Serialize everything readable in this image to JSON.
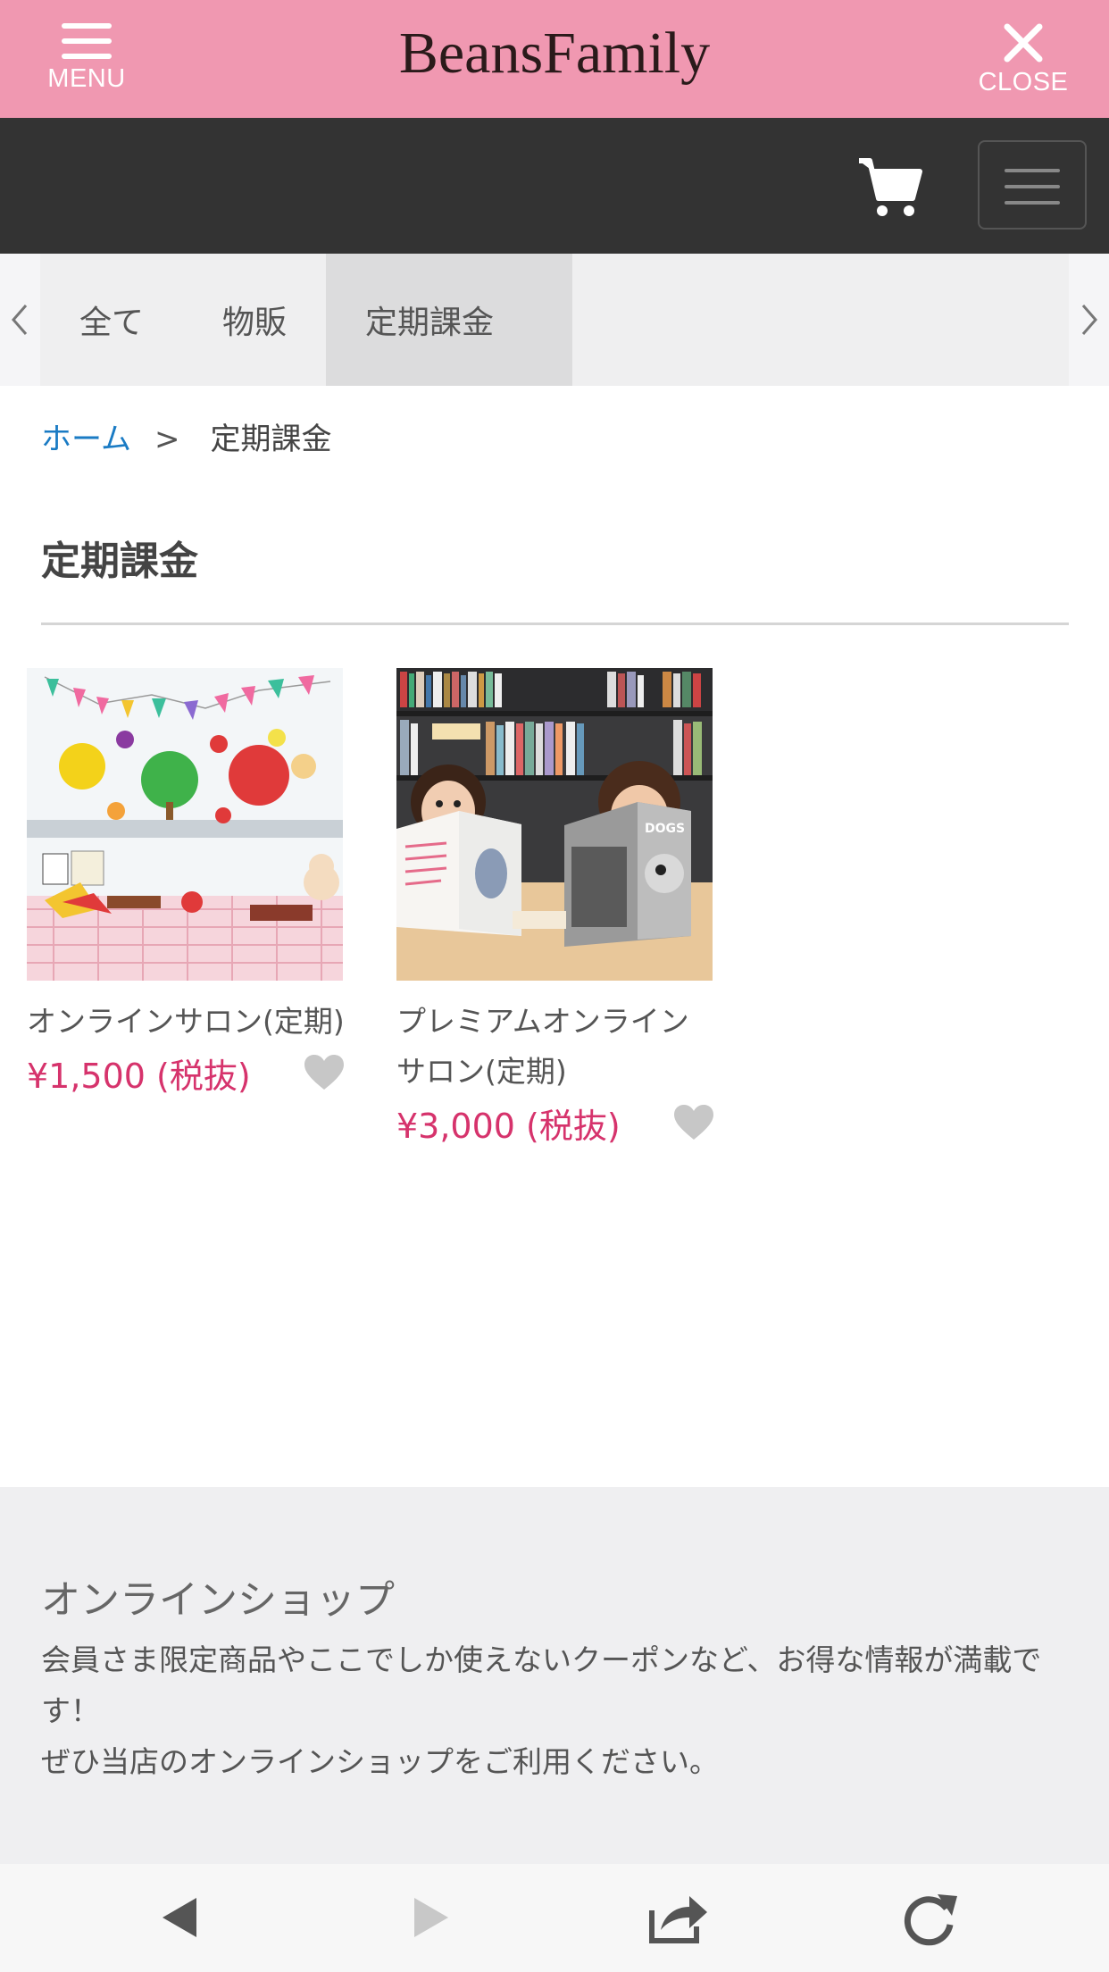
{
  "header": {
    "brand": "BeansFamily",
    "menu_label": "MENU",
    "close_label": "CLOSE",
    "color": "#f098b1"
  },
  "nav": {
    "cart_icon": "cart-icon",
    "menu_icon": "hamburger-icon"
  },
  "tabs": [
    {
      "label": "全て",
      "active": false
    },
    {
      "label": "物販",
      "active": false
    },
    {
      "label": "定期課金",
      "active": true
    }
  ],
  "breadcrumb": {
    "home": "ホーム",
    "separator": ">",
    "current": "定期課金"
  },
  "page": {
    "title": "定期課金"
  },
  "products": [
    {
      "name": "オンラインサロン(定期)",
      "price": "¥1,500 (税抜)",
      "image": "classroom-display-photo"
    },
    {
      "name": "プレミアムオンラインサロン(定期)",
      "price": "¥3,000 (税抜)",
      "image": "two-women-reading-books-photo"
    }
  ],
  "shop_info": {
    "title": "オンラインショップ",
    "line1": "会員さま限定商品やここでしか使えないクーポンなど、お得な情報が満載です！",
    "line2": "ぜひ当店のオンラインショップをご利用ください。"
  },
  "browser_toolbar": {
    "icons": [
      "back-icon",
      "forward-icon",
      "share-icon",
      "reload-icon"
    ]
  },
  "colors": {
    "price": "#d6336c",
    "link": "#1a7bc4",
    "dark_bar": "#333333"
  }
}
